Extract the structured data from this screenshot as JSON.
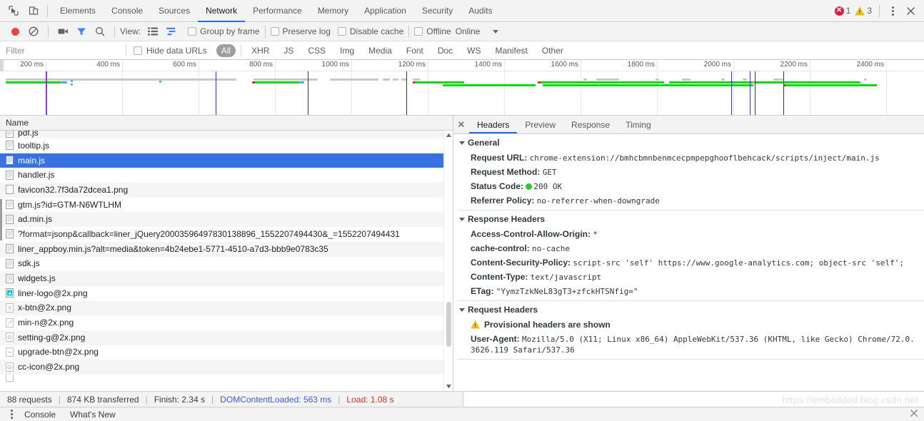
{
  "tabstrip": {
    "icons": [
      {
        "name": "inspect-element-icon",
        "label": "Inspect element"
      },
      {
        "name": "device-toolbar-icon",
        "label": "Toggle device toolbar"
      }
    ],
    "tabs": [
      {
        "label": "Elements",
        "active": false
      },
      {
        "label": "Console",
        "active": false
      },
      {
        "label": "Sources",
        "active": false
      },
      {
        "label": "Network",
        "active": true
      },
      {
        "label": "Performance",
        "active": false
      },
      {
        "label": "Memory",
        "active": false
      },
      {
        "label": "Application",
        "active": false
      },
      {
        "label": "Security",
        "active": false
      },
      {
        "label": "Audits",
        "active": false
      }
    ],
    "error_count": "1",
    "warning_count": "3",
    "error_glyph": "✕",
    "more_label": "more-options",
    "close_label": "✕"
  },
  "netbar": {
    "record_label": "record-button",
    "clear_label": "clear-button",
    "screenshot_label": "capture-screenshots",
    "filter_label": "filter-button",
    "search_label": "search-button",
    "view_label": "View:",
    "view_list_label": "list-view",
    "view_waterfall_label": "waterfall-view",
    "group_by_frame": "Group by frame",
    "preserve_log": "Preserve log",
    "disable_cache": "Disable cache",
    "offline": "Offline",
    "throttling": "Online"
  },
  "filterbar": {
    "placeholder": "Filter",
    "value": "",
    "hide_data_urls": "Hide data URLs",
    "types": [
      {
        "label": "All",
        "active": true
      },
      {
        "label": "XHR",
        "active": false
      },
      {
        "label": "JS",
        "active": false
      },
      {
        "label": "CSS",
        "active": false
      },
      {
        "label": "Img",
        "active": false
      },
      {
        "label": "Media",
        "active": false
      },
      {
        "label": "Font",
        "active": false
      },
      {
        "label": "Doc",
        "active": false
      },
      {
        "label": "WS",
        "active": false
      },
      {
        "label": "Manifest",
        "active": false
      },
      {
        "label": "Other",
        "active": false
      }
    ]
  },
  "overview": {
    "ticks": [
      "200 ms",
      "400 ms",
      "600 ms",
      "800 ms",
      "1000 ms",
      "1200 ms",
      "1400 ms",
      "1600 ms",
      "1800 ms",
      "2000 ms",
      "2200 ms",
      "2400 ms"
    ],
    "colors": {
      "green": "#12d612",
      "gray": "#c8c8c8",
      "blue": "#3a3ad0",
      "red": "#8e1220",
      "purple": "#9b30f0",
      "lightblue": "#4da6ff"
    }
  },
  "list": {
    "column_name": "Name",
    "rows": [
      {
        "name": "pdf.js",
        "icon": "script-icon",
        "selected": false,
        "clipped": true
      },
      {
        "name": "tooltip.js",
        "icon": "script-icon",
        "selected": false
      },
      {
        "name": "main.js",
        "icon": "script-icon",
        "selected": true
      },
      {
        "name": "handler.js",
        "icon": "script-icon",
        "selected": false
      },
      {
        "name": "favicon32.7f3da72dcea1.png",
        "icon": "image-icon",
        "selected": false
      },
      {
        "name": "gtm.js?id=GTM-N6WTLHM",
        "icon": "script-icon",
        "selected": false
      },
      {
        "name": "ad.min.js",
        "icon": "script-icon",
        "selected": false
      },
      {
        "name": "?format=jsonp&callback=liner_jQuery20003596497830138896_1552207494430&_=1552207494431",
        "icon": "script-icon",
        "selected": false
      },
      {
        "name": "liner_appboy.min.js?alt=media&token=4b24ebe1-5771-4510-a7d3-bbb9e0783c35",
        "icon": "script-icon",
        "selected": false
      },
      {
        "name": "sdk.js",
        "icon": "script-icon",
        "selected": false
      },
      {
        "name": "widgets.js",
        "icon": "script-icon",
        "selected": false
      },
      {
        "name": "liner-logo@2x.png",
        "icon": "image-thumb-icon",
        "selected": false
      },
      {
        "name": "x-btn@2x.png",
        "icon": "image-thumb-icon",
        "selected": false
      },
      {
        "name": "min-n@2x.png",
        "icon": "image-thumb-icon",
        "selected": false
      },
      {
        "name": "setting-g@2x.png",
        "icon": "image-thumb-icon",
        "selected": false
      },
      {
        "name": "upgrade-btn@2x.png",
        "icon": "image-thumb-icon",
        "selected": false
      },
      {
        "name": "cc-icon@2x.png",
        "icon": "image-thumb-icon",
        "selected": false
      }
    ]
  },
  "detail": {
    "close_glyph": "✕",
    "tabs": [
      {
        "label": "Headers",
        "active": true
      },
      {
        "label": "Preview",
        "active": false
      },
      {
        "label": "Response",
        "active": false
      },
      {
        "label": "Timing",
        "active": false
      }
    ],
    "general": {
      "title": "General",
      "items": [
        {
          "key": "Request URL:",
          "value": "chrome-extension://bmhcbmnbenmcecpmpepghooflbehcack/scripts/inject/main.js"
        },
        {
          "key": "Request Method:",
          "value": "GET"
        },
        {
          "key": "Status Code:",
          "value": "200 OK",
          "status": true
        },
        {
          "key": "Referrer Policy:",
          "value": "no-referrer-when-downgrade"
        }
      ]
    },
    "response_headers": {
      "title": "Response Headers",
      "items": [
        {
          "key": "Access-Control-Allow-Origin:",
          "value": "*"
        },
        {
          "key": "cache-control:",
          "value": "no-cache"
        },
        {
          "key": "Content-Security-Policy:",
          "value": "script-src 'self' https://www.google-analytics.com; object-src 'self';"
        },
        {
          "key": "Content-Type:",
          "value": "text/javascript"
        },
        {
          "key": "ETag:",
          "value": "\"YymzTzkNeL83gT3+zfckHTSNfig=\""
        }
      ]
    },
    "request_headers": {
      "title": "Request Headers",
      "provisional": "Provisional headers are shown",
      "items": [
        {
          "key": "User-Agent:",
          "value": "Mozilla/5.0 (X11; Linux x86_64) AppleWebKit/537.36 (KHTML, like Gecko) Chrome/72.0.3626.119 Safari/537.36"
        }
      ]
    }
  },
  "statusbar": {
    "requests": "88 requests",
    "transferred": "874 KB transferred",
    "finish": "Finish: 2.34 s",
    "dom_content_loaded": "DOMContentLoaded: 563 ms",
    "load": "Load: 1.08 s",
    "separator": "|"
  },
  "drawer": {
    "tabs": [
      {
        "label": "Console"
      },
      {
        "label": "What's New"
      }
    ],
    "close_glyph": "✕"
  },
  "watermark": "https://embedded.blog.csdn.net"
}
